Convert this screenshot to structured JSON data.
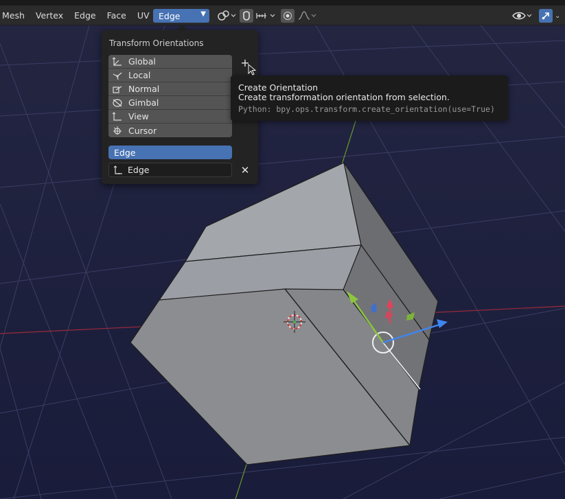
{
  "header": {
    "menus": [
      "Mesh",
      "Vertex",
      "Edge",
      "Face",
      "UV"
    ],
    "orientation_value": "Edge"
  },
  "popover": {
    "title": "Transform Orientations",
    "orientations": [
      {
        "label": "Global",
        "icon": "global-orientation-icon"
      },
      {
        "label": "Local",
        "icon": "local-orientation-icon"
      },
      {
        "label": "Normal",
        "icon": "normal-orientation-icon"
      },
      {
        "label": "Gimbal",
        "icon": "gimbal-orientation-icon"
      },
      {
        "label": "View",
        "icon": "view-orientation-icon"
      },
      {
        "label": "Cursor",
        "icon": "cursor-orientation-icon"
      }
    ],
    "add_symbol": "+",
    "selected": "Edge",
    "custom_name": "Edge",
    "delete_symbol": "✕"
  },
  "tooltip": {
    "title": "Create Orientation",
    "description": "Create transformation orientation from selection.",
    "python": "Python: bpy.ops.transform.create_orientation(use=True)"
  },
  "colors": {
    "accent": "#4772b3",
    "viewport_bg": "#1b1f3b",
    "x_axis": "#c8303f",
    "y_axis": "#7fb33a",
    "z_axis": "#2f7fe0"
  }
}
